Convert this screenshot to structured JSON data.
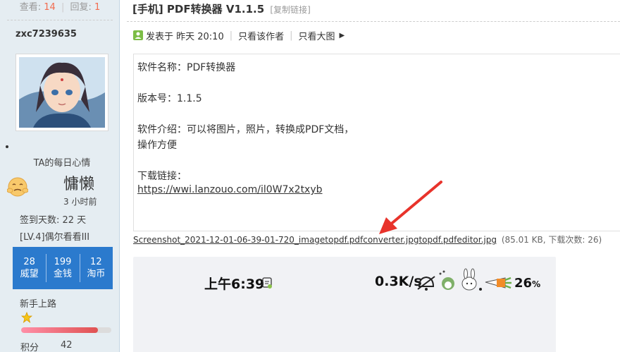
{
  "sidebar": {
    "views_label": "查看:",
    "views": "14",
    "replies_label": "回复:",
    "replies": "1",
    "username": "zxc7239635",
    "mood_title": "TA的每日心情",
    "mood_word": "慵懒",
    "mood_time": "3 小时前",
    "sign_days": "签到天数: 22 天",
    "level": "[LV.4]偶尔看看III",
    "stats": [
      {
        "value": "28",
        "label": "威望"
      },
      {
        "value": "199",
        "label": "金钱"
      },
      {
        "value": "12",
        "label": "淘币"
      }
    ],
    "rank": "新手上路",
    "rank_progress": 0.85,
    "points_label": "积分",
    "points_value": "42"
  },
  "post": {
    "title": "[手机] PDF转换器 V1.1.5",
    "copy_link": "[复制链接]",
    "posted_at": "发表于 昨天 20:10",
    "only_author": "只看该作者",
    "large_image": "只看大图",
    "lines": [
      "软件名称：PDF转换器",
      "版本号：1.1.5",
      "软件介绍：可以将图片，照片，转换成PDF文档，",
      "操作方便",
      "下载链接："
    ],
    "download_url": "https://wwi.lanzouo.com/il0W7x2txyb",
    "attachment_name": "Screenshot_2021-12-01-06-39-01-720_imagetopdf.pdfconverter.jpgtopdf.pdfeditor.jpg",
    "attachment_meta": "(85.01 KB, 下载次数: 26)"
  },
  "phone": {
    "time": "上午6:39",
    "speed": "0.3K/s",
    "battery": "26",
    "battery_unit": "%"
  },
  "colors": {
    "accent_blue": "#2b7acd",
    "count_orange": "#f26c4f",
    "arrow_red": "#e8332b"
  }
}
